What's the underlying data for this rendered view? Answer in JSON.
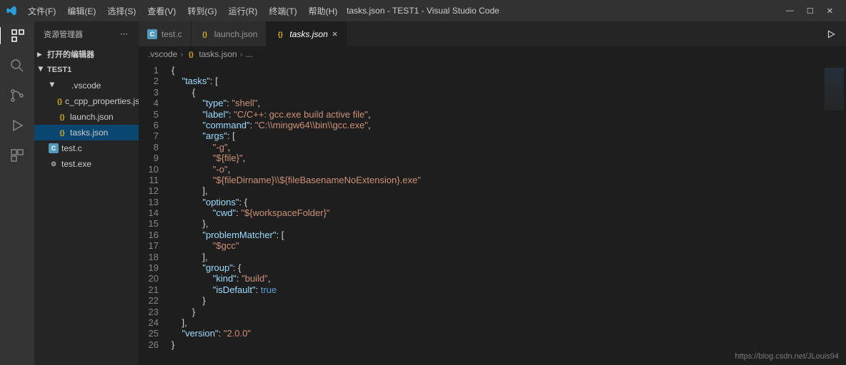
{
  "title": "tasks.json - TEST1 - Visual Studio Code",
  "menu": [
    "文件(F)",
    "编辑(E)",
    "选择(S)",
    "查看(V)",
    "转到(G)",
    "运行(R)",
    "终端(T)",
    "帮助(H)"
  ],
  "sidebar": {
    "header": "资源管理器",
    "sections": [
      {
        "label": "打开的编辑器",
        "chev": "closed"
      },
      {
        "label": "TEST1",
        "chev": "open"
      }
    ],
    "tree": [
      {
        "indent": 1,
        "chev": "open",
        "icon": "",
        "label": ".vscode"
      },
      {
        "indent": 2,
        "icon": "json",
        "label": "c_cpp_properties.json"
      },
      {
        "indent": 2,
        "icon": "json",
        "label": "launch.json"
      },
      {
        "indent": 2,
        "icon": "json",
        "label": "tasks.json",
        "selected": true
      },
      {
        "indent": 1,
        "icon": "c",
        "label": "test.c"
      },
      {
        "indent": 1,
        "icon": "exe",
        "label": "test.exe"
      }
    ]
  },
  "tabs": [
    {
      "icon": "c",
      "label": "test.c",
      "active": false
    },
    {
      "icon": "json",
      "label": "launch.json",
      "active": false
    },
    {
      "icon": "json",
      "label": "tasks.json",
      "active": true,
      "close": true
    }
  ],
  "breadcrumb": [
    ".vscode",
    "tasks.json",
    "..."
  ],
  "code_lines": [
    "{",
    "    \"tasks\": [",
    "        {",
    "            \"type\": \"shell\",",
    "            \"label\": \"C/C++: gcc.exe build active file\",",
    "            \"command\": \"C:\\\\mingw64\\\\bin\\\\gcc.exe\",",
    "            \"args\": [",
    "                \"-g\",",
    "                \"${file}\",",
    "                \"-o\",",
    "                \"${fileDirname}\\\\${fileBasenameNoExtension}.exe\"",
    "            ],",
    "            \"options\": {",
    "                \"cwd\": \"${workspaceFolder}\"",
    "            },",
    "            \"problemMatcher\": [",
    "                \"$gcc\"",
    "            ],",
    "            \"group\": {",
    "                \"kind\": \"build\",",
    "                \"isDefault\": true",
    "            }",
    "        }",
    "    ],",
    "    \"version\": \"2.0.0\"",
    "}"
  ],
  "watermark": "https://blog.csdn.net/JLouis94"
}
